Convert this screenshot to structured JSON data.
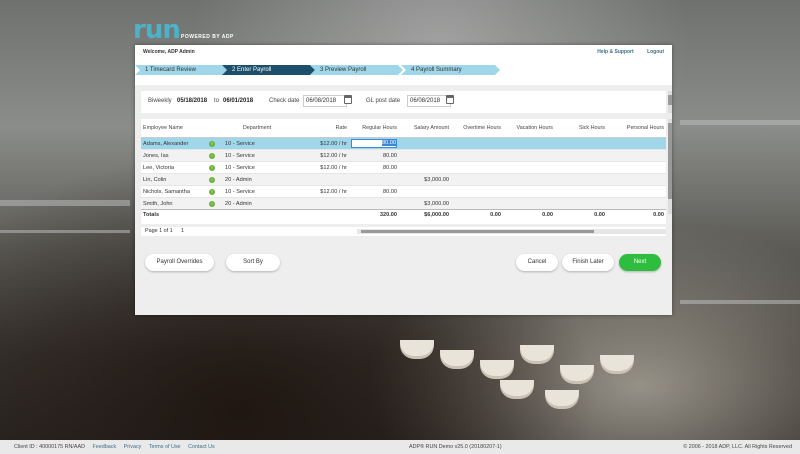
{
  "brand": {
    "logo": "run",
    "powered_by": "POWERED BY ADP"
  },
  "header": {
    "welcome": "Welcome, ADP Admin",
    "help": "Help & Support",
    "logout": "Logout"
  },
  "steps": [
    {
      "label": "1   Timecard Review"
    },
    {
      "label": "2   Enter Payroll"
    },
    {
      "label": "3   Preview Payroll"
    },
    {
      "label": "4   Payroll Summary"
    }
  ],
  "period": {
    "frequency": "Biweekly",
    "start": "05/18/2018",
    "to": "to",
    "end": "06/01/2018",
    "check_date_label": "Check date",
    "check_date": "06/08/2018",
    "gl_post_label": "GL post date",
    "gl_post_date": "06/08/2018"
  },
  "table": {
    "headers": {
      "name": "Employee Name",
      "dept": "Department",
      "rate": "Rate",
      "regular": "Regular Hours",
      "salary": "Salary Amount",
      "overtime": "Overtime Hours",
      "vacation": "Vacation Hours",
      "sick": "Sick Hours",
      "personal": "Personal Hours"
    },
    "rows": [
      {
        "name": "Adams, Alexander",
        "dept": "10 - Service",
        "rate": "$12.00 / hr",
        "regular": "80.00",
        "salary": ""
      },
      {
        "name": "Jones, Ias",
        "dept": "10 - Service",
        "rate": "$12.00 / hr",
        "regular": "80.00",
        "salary": ""
      },
      {
        "name": "Lee, Victoria",
        "dept": "10 - Service",
        "rate": "$12.00 / hr",
        "regular": "80.00",
        "salary": ""
      },
      {
        "name": "Lin, Colin",
        "dept": "20 - Admin",
        "rate": "",
        "regular": "",
        "salary": "$3,000.00"
      },
      {
        "name": "Nichols, Samantha",
        "dept": "10 - Service",
        "rate": "$12.00 / hr",
        "regular": "80.00",
        "salary": ""
      },
      {
        "name": "Smith, John",
        "dept": "20 - Admin",
        "rate": "",
        "regular": "",
        "salary": "$3,000.00"
      }
    ],
    "totals": {
      "label": "Totals",
      "regular": "320.00",
      "salary": "$6,000.00",
      "overtime": "0.00",
      "vacation": "0.00",
      "sick": "0.00",
      "personal": "0.00"
    }
  },
  "pager": {
    "text": "Page 1 of 1",
    "page": "1"
  },
  "buttons": {
    "payroll_overrides": "Payroll Overrides",
    "sort_by": "Sort By",
    "cancel": "Cancel",
    "finish_later": "Finish Later",
    "next": "Next"
  },
  "footer": {
    "client_id": "Client ID : 40000175 RN/AAD",
    "feedback": "Feedback",
    "privacy": "Privacy",
    "terms": "Terms of Use",
    "contact": "Contact Us",
    "version": "ADP® RUN Demo v25.0 (20180207-1)",
    "copyright": "© 2006 - 2018 ADP, LLC. All Rights Reserved"
  },
  "colors": {
    "accent": "#9fd6ea",
    "step_active": "#1e4f6a",
    "next_button": "#2ebd3e",
    "logo_blue": "#4db2c8",
    "logo_green": "#8cc63f"
  }
}
